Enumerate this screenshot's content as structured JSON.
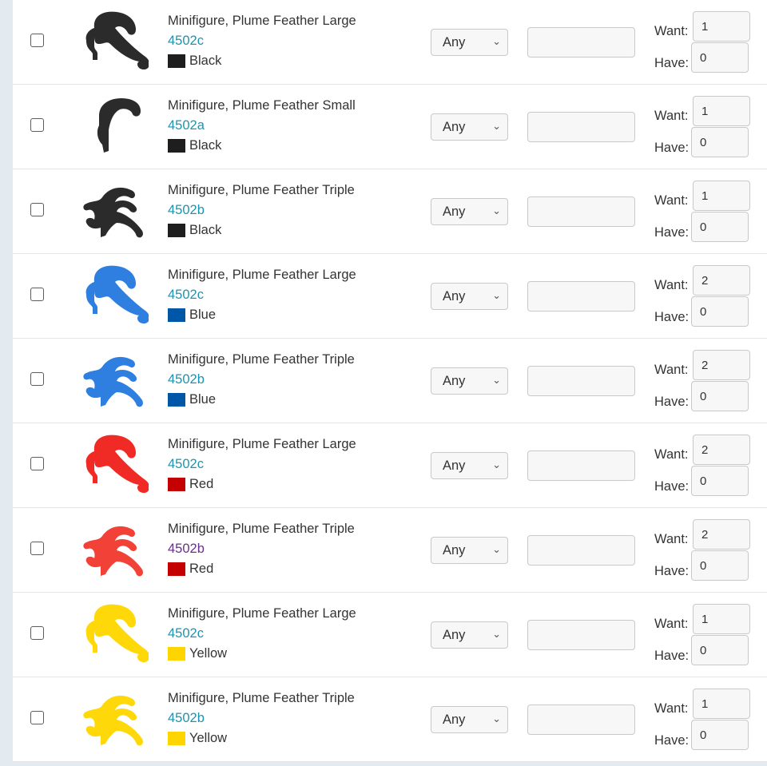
{
  "colors": {
    "Black": "#1e1e1e",
    "Blue": "#0057a8",
    "Red": "#c40000",
    "Yellow": "#ffd500"
  },
  "rows": [
    {
      "name": "Minifigure, Plume Feather Large",
      "part": "4502c",
      "color": "Black",
      "condition": "Any",
      "want": "1",
      "have": "0",
      "want_label": "Want:",
      "have_label": "Have:",
      "shape": "large",
      "fill": "#2b2b2b",
      "visited": false
    },
    {
      "name": "Minifigure, Plume Feather Small",
      "part": "4502a",
      "color": "Black",
      "condition": "Any",
      "want": "1",
      "have": "0",
      "want_label": "Want:",
      "have_label": "Have:",
      "shape": "small",
      "fill": "#2b2b2b",
      "visited": false
    },
    {
      "name": "Minifigure, Plume Feather Triple",
      "part": "4502b",
      "color": "Black",
      "condition": "Any",
      "want": "1",
      "have": "0",
      "want_label": "Want:",
      "have_label": "Have:",
      "shape": "triple",
      "fill": "#2b2b2b",
      "visited": false
    },
    {
      "name": "Minifigure, Plume Feather Large",
      "part": "4502c",
      "color": "Blue",
      "condition": "Any",
      "want": "2",
      "have": "0",
      "want_label": "Want:",
      "have_label": "Have:",
      "shape": "large",
      "fill": "#2f7fe0",
      "visited": false
    },
    {
      "name": "Minifigure, Plume Feather Triple",
      "part": "4502b",
      "color": "Blue",
      "condition": "Any",
      "want": "2",
      "have": "0",
      "want_label": "Want:",
      "have_label": "Have:",
      "shape": "triple",
      "fill": "#2f7fe0",
      "visited": false
    },
    {
      "name": "Minifigure, Plume Feather Large",
      "part": "4502c",
      "color": "Red",
      "condition": "Any",
      "want": "2",
      "have": "0",
      "want_label": "Want:",
      "have_label": "Have:",
      "shape": "large",
      "fill": "#f02a24",
      "visited": false
    },
    {
      "name": "Minifigure, Plume Feather Triple",
      "part": "4502b",
      "color": "Red",
      "condition": "Any",
      "want": "2",
      "have": "0",
      "want_label": "Want:",
      "have_label": "Have:",
      "shape": "triple",
      "fill": "#f24238",
      "visited": true
    },
    {
      "name": "Minifigure, Plume Feather Large",
      "part": "4502c",
      "color": "Yellow",
      "condition": "Any",
      "want": "1",
      "have": "0",
      "want_label": "Want:",
      "have_label": "Have:",
      "shape": "large",
      "fill": "#ffd80a",
      "visited": false
    },
    {
      "name": "Minifigure, Plume Feather Triple",
      "part": "4502b",
      "color": "Yellow",
      "condition": "Any",
      "want": "1",
      "have": "0",
      "want_label": "Want:",
      "have_label": "Have:",
      "shape": "triple",
      "fill": "#ffd80a",
      "visited": false
    }
  ]
}
